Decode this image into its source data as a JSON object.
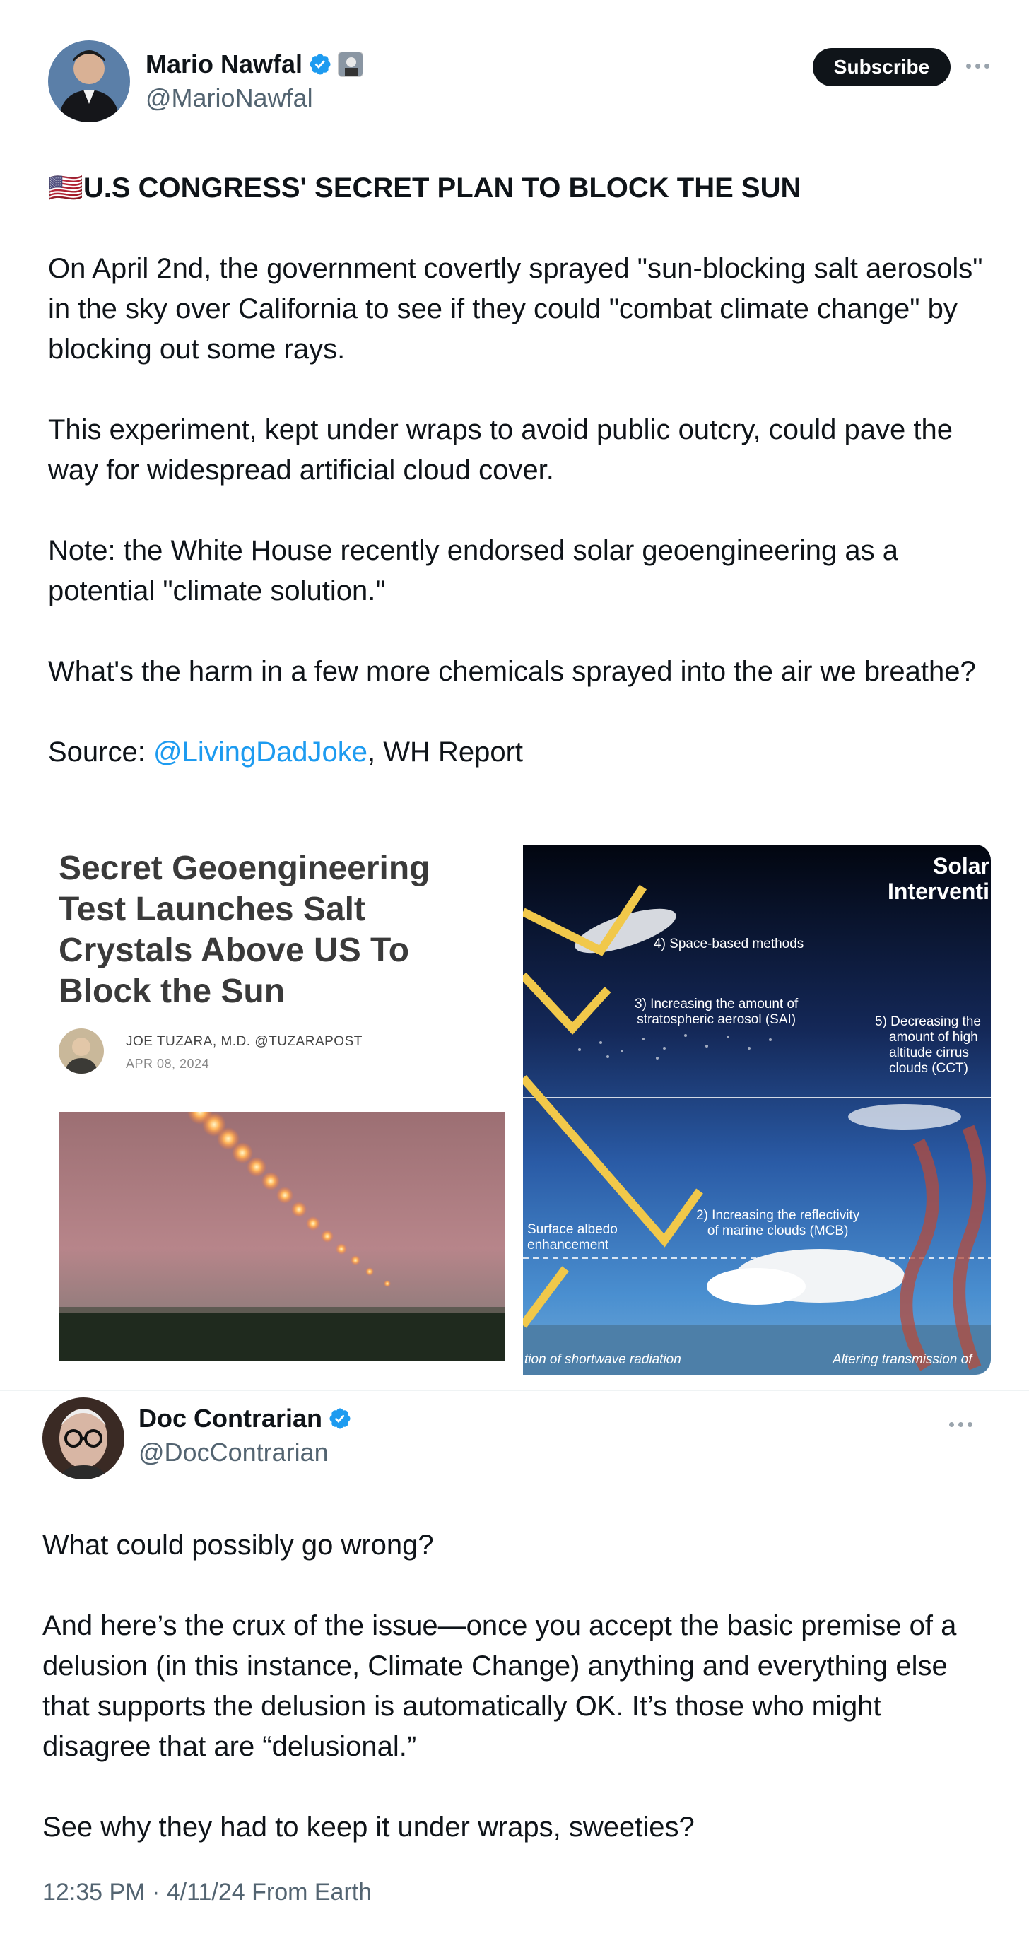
{
  "tweet1": {
    "display_name": "Mario Nawfal",
    "handle": "@MarioNawfal",
    "subscribe_label": "Subscribe",
    "headline_flag": "🇺🇸",
    "headline": "U.S CONGRESS' SECRET PLAN TO BLOCK THE SUN",
    "p1": "On April 2nd, the government covertly sprayed \"sun-blocking salt aerosols\" in the sky over California to see if they could \"combat climate change\" by blocking out some rays.",
    "p2": "This experiment, kept under wraps to avoid public outcry, could pave the way for widespread artificial cloud cover.",
    "p3": "Note: the White House recently endorsed solar geoengineering as a potential \"climate solution.\"",
    "p4": "What's the harm in a few more chemicals sprayed into the air we breathe?",
    "source_prefix": "Source: ",
    "source_link": "@LivingDadJoke",
    "source_suffix": ", WH Report",
    "article": {
      "title": "Secret Geoengineering Test Launches Salt Crystals Above US To Block the Sun",
      "author": "JOE TUZARA, M.D. @TUZARAPOST",
      "date": "APR 08, 2024"
    },
    "diagram": {
      "title_line1": "Solar",
      "title_line2": "Interventi",
      "label_space": "4) Space-based methods",
      "label_sai_1": "3) Increasing the amount of",
      "label_sai_2": "stratospheric aerosol (SAI)",
      "label_cct_1": "5) Decreasing the",
      "label_cct_2": "amount of high",
      "label_cct_3": "altitude cirrus",
      "label_cct_4": "clouds (CCT)",
      "label_mcb_1": "2) Increasing the reflectivity",
      "label_mcb_2": "of marine clouds (MCB)",
      "label_albedo_1": "Surface albedo",
      "label_albedo_2": "enhancement",
      "bottom_left": "tion of shortwave radiation",
      "bottom_right": "Altering transmission of"
    }
  },
  "tweet2": {
    "display_name": "Doc Contrarian",
    "handle": "@DocContrarian",
    "p1": "What could possibly go wrong?",
    "p2": "And here’s the crux of the issue—once you accept the basic premise of a delusion (in this instance, Climate Change) anything and everything else that supports the delusion is automatically OK. It’s those who might disagree that are “delusional.”",
    "p3": "See why they had to keep it under wraps, sweeties?",
    "timestamp": "12:35 PM · 4/11/24 From Earth"
  },
  "colors": {
    "link": "#1d9bf0",
    "verified": "#1d9bf0",
    "text": "#0f1419",
    "secondary": "#536471"
  },
  "icons": [
    "verified-badge-icon",
    "affiliate-badge-icon",
    "more-options-icon"
  ]
}
